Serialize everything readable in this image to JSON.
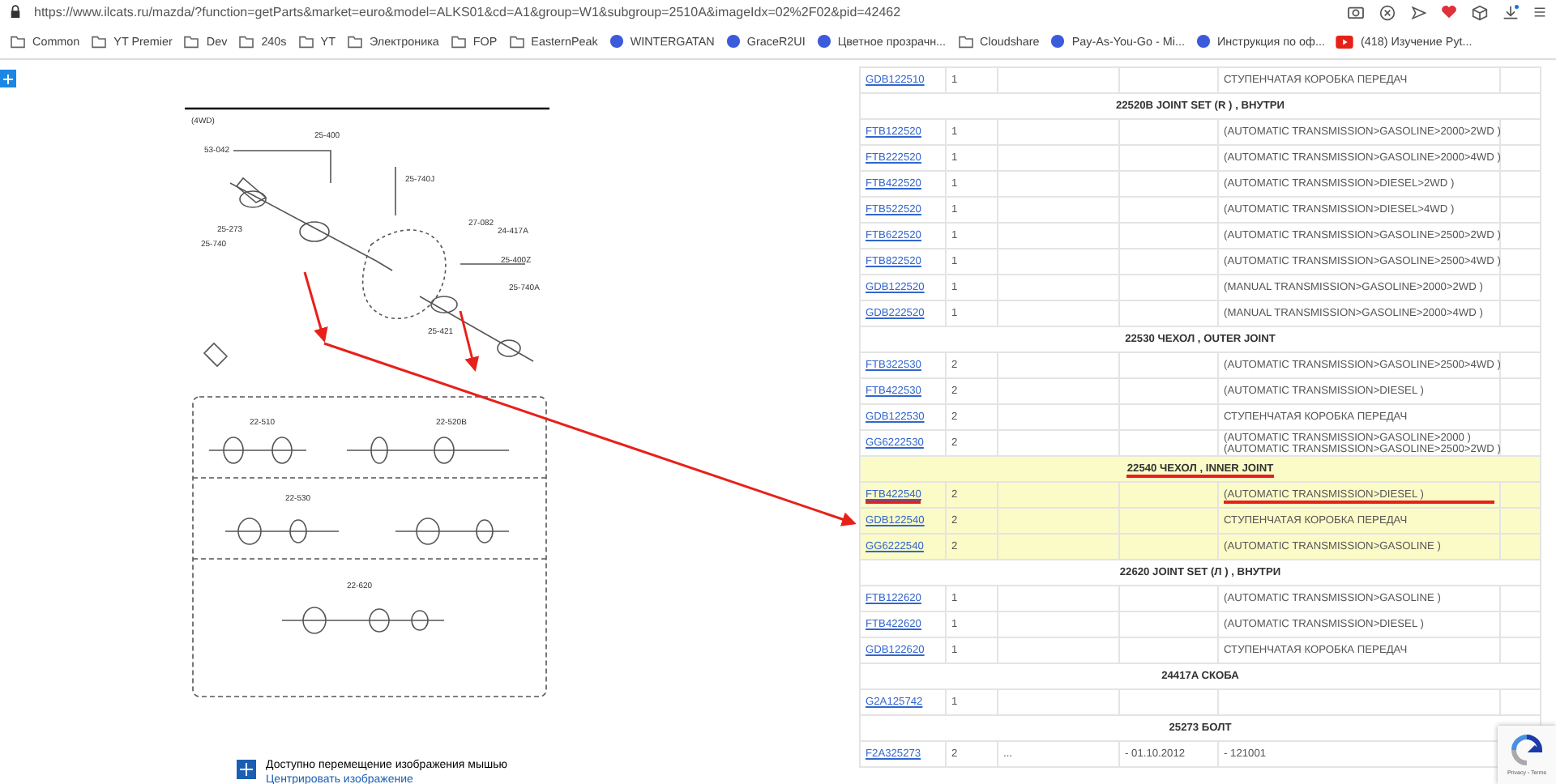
{
  "address_bar": {
    "url": "https://www.ilcats.ru/mazda/?function=getParts&market=euro&model=ALKS01&cd=A1&group=W1&subgroup=2510A&imageIdx=02%2F02&pid=42462"
  },
  "bookmarks": [
    {
      "label": "Common",
      "kind": "folder"
    },
    {
      "label": "YT Premier",
      "kind": "folder"
    },
    {
      "label": "Dev",
      "kind": "folder"
    },
    {
      "label": "240s",
      "kind": "folder"
    },
    {
      "label": "YT",
      "kind": "folder"
    },
    {
      "label": "Электроника",
      "kind": "folder"
    },
    {
      "label": "FOP",
      "kind": "folder"
    },
    {
      "label": "EasternPeak",
      "kind": "folder"
    },
    {
      "label": "WINTERGATAN",
      "kind": "site"
    },
    {
      "label": "GraceR2UI",
      "kind": "site"
    },
    {
      "label": "Цветное прозрачн...",
      "kind": "site"
    },
    {
      "label": "Cloudshare",
      "kind": "folder"
    },
    {
      "label": "Pay-As-You-Go - Mi...",
      "kind": "site"
    },
    {
      "label": "Инструкция по оф...",
      "kind": "site"
    },
    {
      "label": "(418) Изучение Pyt...",
      "kind": "video"
    }
  ],
  "diagram": {
    "labels": [
      "(4WD)",
      "53-042",
      "25-400",
      "25-740J",
      "25-273",
      "25-740",
      "27-082",
      "24-417A",
      "25-400Z",
      "25-740A",
      "25-421",
      "22-510",
      "22-520B",
      "22-530",
      "22-620"
    ]
  },
  "caption": {
    "text": "Доступно перемещение изображения мышью",
    "link": "Центрировать изображение"
  },
  "parts_table": {
    "rows": [
      {
        "kind": "part",
        "part_number": "GDB122510",
        "quantity": "1",
        "description": "СТУПЕНЧАТАЯ КОРОБКА ПЕРЕДАЧ",
        "highlighted": false,
        "marked": false
      },
      {
        "kind": "section",
        "title": "22520B JOINT SET (R ) , ВНУТРИ",
        "highlighted": false,
        "marked": false
      },
      {
        "kind": "part",
        "part_number": "FTB122520",
        "quantity": "1",
        "description": "(AUTOMATIC TRANSMISSION>GASOLINE>2000>2WD )",
        "highlighted": false,
        "marked": false
      },
      {
        "kind": "part",
        "part_number": "FTB222520",
        "quantity": "1",
        "description": "(AUTOMATIC TRANSMISSION>GASOLINE>2000>4WD )",
        "highlighted": false,
        "marked": false
      },
      {
        "kind": "part",
        "part_number": "FTB422520",
        "quantity": "1",
        "description": "(AUTOMATIC TRANSMISSION>DIESEL>2WD )",
        "highlighted": false,
        "marked": false
      },
      {
        "kind": "part",
        "part_number": "FTB522520",
        "quantity": "1",
        "description": "(AUTOMATIC TRANSMISSION>DIESEL>4WD )",
        "highlighted": false,
        "marked": false
      },
      {
        "kind": "part",
        "part_number": "FTB622520",
        "quantity": "1",
        "description": "(AUTOMATIC TRANSMISSION>GASOLINE>2500>2WD )",
        "highlighted": false,
        "marked": false
      },
      {
        "kind": "part",
        "part_number": "FTB822520",
        "quantity": "1",
        "description": "(AUTOMATIC TRANSMISSION>GASOLINE>2500>4WD )",
        "highlighted": false,
        "marked": false
      },
      {
        "kind": "part",
        "part_number": "GDB122520",
        "quantity": "1",
        "description": "(MANUAL TRANSMISSION>GASOLINE>2000>2WD )",
        "highlighted": false,
        "marked": false
      },
      {
        "kind": "part",
        "part_number": "GDB222520",
        "quantity": "1",
        "description": "(MANUAL TRANSMISSION>GASOLINE>2000>4WD )",
        "highlighted": false,
        "marked": false
      },
      {
        "kind": "section",
        "title": "22530 ЧЕХОЛ , OUTER JOINT",
        "highlighted": false,
        "marked": false
      },
      {
        "kind": "part",
        "part_number": "FTB322530",
        "quantity": "2",
        "description": "(AUTOMATIC TRANSMISSION>GASOLINE>2500>4WD )",
        "highlighted": false,
        "marked": false
      },
      {
        "kind": "part",
        "part_number": "FTB422530",
        "quantity": "2",
        "description": "(AUTOMATIC TRANSMISSION>DIESEL )",
        "highlighted": false,
        "marked": false
      },
      {
        "kind": "part",
        "part_number": "GDB122530",
        "quantity": "2",
        "description": "СТУПЕНЧАТАЯ КОРОБКА ПЕРЕДАЧ",
        "highlighted": false,
        "marked": false
      },
      {
        "kind": "part",
        "part_number": "GG6222530",
        "quantity": "2",
        "description": "(AUTOMATIC TRANSMISSION>GASOLINE>2000 )",
        "description_2": "(AUTOMATIC TRANSMISSION>GASOLINE>2500>2WD )",
        "highlighted": false,
        "marked": false
      },
      {
        "kind": "section",
        "title": "22540 ЧЕХОЛ , INNER JOINT",
        "highlighted": true,
        "marked": true
      },
      {
        "kind": "part",
        "part_number": "FTB422540",
        "quantity": "2",
        "description": "(AUTOMATIC TRANSMISSION>DIESEL )",
        "highlighted": true,
        "marked": true
      },
      {
        "kind": "part",
        "part_number": "GDB122540",
        "quantity": "2",
        "description": "СТУПЕНЧАТАЯ КОРОБКА ПЕРЕДАЧ",
        "highlighted": true,
        "marked": false
      },
      {
        "kind": "part",
        "part_number": "GG6222540",
        "quantity": "2",
        "description": "(AUTOMATIC TRANSMISSION>GASOLINE )",
        "highlighted": true,
        "marked": false
      },
      {
        "kind": "section",
        "title": "22620 JOINT SET (Л ) , ВНУТРИ",
        "highlighted": false,
        "marked": false
      },
      {
        "kind": "part",
        "part_number": "FTB122620",
        "quantity": "1",
        "description": "(AUTOMATIC TRANSMISSION>GASOLINE )",
        "highlighted": false,
        "marked": false
      },
      {
        "kind": "part",
        "part_number": "FTB422620",
        "quantity": "1",
        "description": "(AUTOMATIC TRANSMISSION>DIESEL )",
        "highlighted": false,
        "marked": false
      },
      {
        "kind": "part",
        "part_number": "GDB122620",
        "quantity": "1",
        "description": "СТУПЕНЧАТАЯ КОРОБКА ПЕРЕДАЧ",
        "highlighted": false,
        "marked": false
      },
      {
        "kind": "section",
        "title": "24417A СКОБА",
        "highlighted": false,
        "marked": false
      },
      {
        "kind": "part",
        "part_number": "G2A125742",
        "quantity": "1",
        "highlighted": false,
        "marked": false
      },
      {
        "kind": "section",
        "title": "25273 БОЛТ",
        "highlighted": false,
        "marked": false
      },
      {
        "kind": "part",
        "part_number": "F2A325273",
        "quantity": "2",
        "column_3": "...",
        "column_4": "- 01.10.2012",
        "description": "- 121001",
        "highlighted": false,
        "marked": false
      }
    ]
  },
  "recaptcha": {
    "links": "Privacy - Terms"
  }
}
